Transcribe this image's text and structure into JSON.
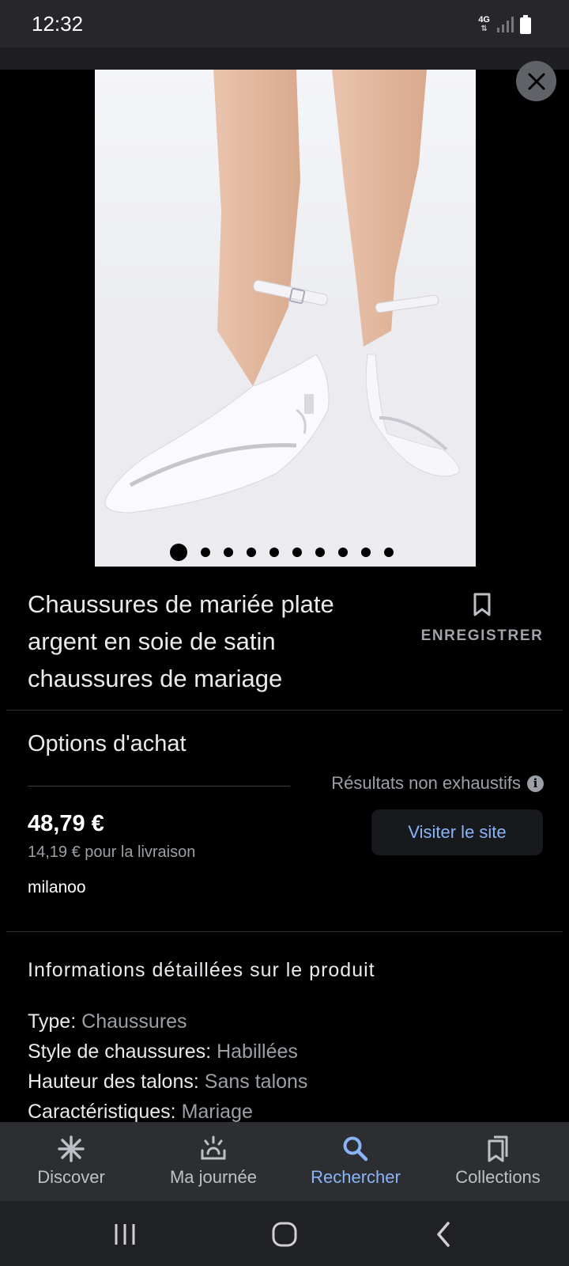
{
  "status_bar": {
    "time": "12:32",
    "network": "4G"
  },
  "carousel": {
    "dot_count": 10,
    "active_index": 0
  },
  "product": {
    "title": "Chaussures de mariée plate argent en soie de satin chaussures de mariage",
    "save_label": "ENREGISTRER"
  },
  "purchase": {
    "section_title": "Options d'achat",
    "disclaimer": "Résultats non exhaustifs",
    "price": "48,79 €",
    "shipping": "14,19 € pour la livraison",
    "merchant": "milanoo",
    "visit_label": "Visiter le site"
  },
  "details": {
    "section_title": "Informations détaillées sur le produit",
    "attributes": [
      {
        "key": "Type:",
        "value": "Chaussures"
      },
      {
        "key": "Style de chaussures:",
        "value": "Habillées"
      },
      {
        "key": "Hauteur des talons:",
        "value": "Sans talons"
      },
      {
        "key": "Caractéristiques:",
        "value": "Mariage"
      }
    ]
  },
  "bottom_nav": {
    "items": [
      {
        "label": "Discover",
        "icon": "asterisk-icon",
        "active": false
      },
      {
        "label": "Ma journée",
        "icon": "sunrise-icon",
        "active": false
      },
      {
        "label": "Rechercher",
        "icon": "search-icon",
        "active": true
      },
      {
        "label": "Collections",
        "icon": "collections-icon",
        "active": false
      }
    ]
  },
  "colors": {
    "accent": "#8ab4f8",
    "background": "#000000",
    "nav_background": "#2d2e31",
    "muted_text": "#9aa0a6"
  }
}
